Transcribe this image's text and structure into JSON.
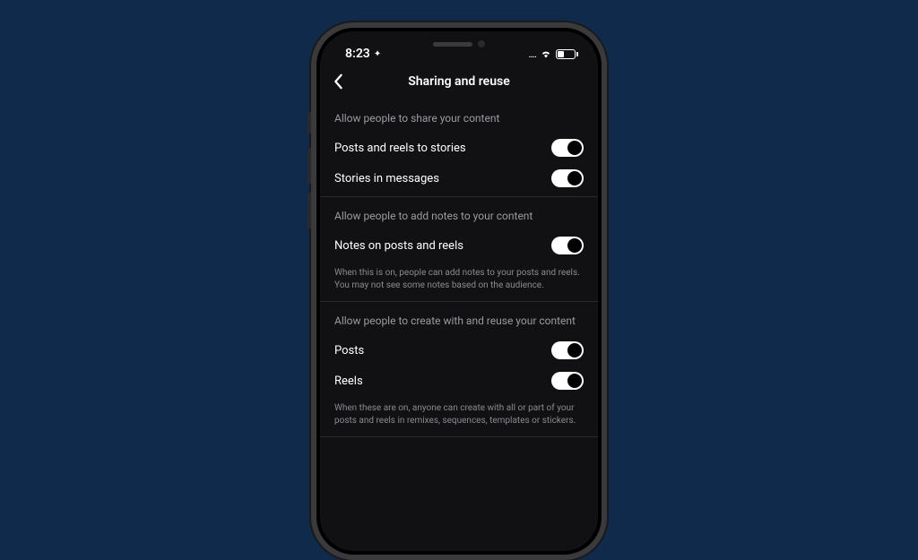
{
  "status": {
    "time": "8:23",
    "loc_icon": "✦",
    "signal": "....",
    "battery_level": "33"
  },
  "header": {
    "title": "Sharing and reuse"
  },
  "sections": {
    "share": {
      "title": "Allow people to share your content",
      "items": {
        "posts_reels_stories": "Posts and reels to stories",
        "stories_messages": "Stories in messages"
      }
    },
    "notes": {
      "title": "Allow people to add notes to your content",
      "items": {
        "notes_posts_reels": "Notes on posts and reels"
      },
      "description": "When this is on, people can add notes to your posts and reels. You may not see some notes based on the audience."
    },
    "reuse": {
      "title": "Allow people to create with and reuse your content",
      "items": {
        "posts": "Posts",
        "reels": "Reels"
      },
      "description": "When these are on, anyone can create with all or part of your posts and reels in remixes, sequences, templates or stickers."
    }
  }
}
